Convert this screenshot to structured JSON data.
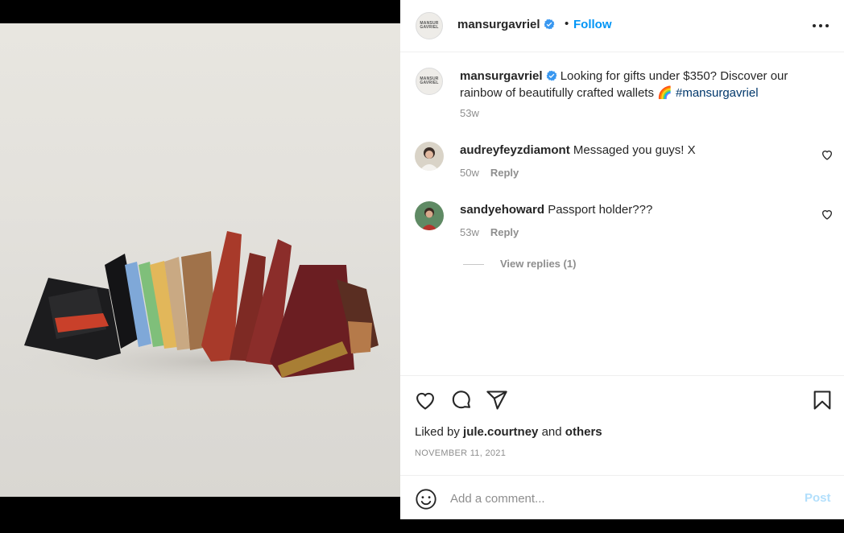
{
  "post": {
    "author": "mansurgavriel",
    "avatar_text": "MANSUR GAVRIEL",
    "follow_label": "Follow",
    "separator": "•",
    "more_icon": "more-horizontal-icon"
  },
  "caption": {
    "username": "mansurgavriel",
    "text": "Looking for gifts under $350? Discover our rainbow of beautifully crafted wallets 🌈",
    "hashtag": "#mansurgavriel",
    "time": "53w"
  },
  "comments": [
    {
      "username": "audreyfeyzdiamont",
      "text": "Messaged you guys! X",
      "time": "50w",
      "reply_label": "Reply"
    },
    {
      "username": "sandyehoward",
      "text": "Passport holder???",
      "time": "53w",
      "reply_label": "Reply"
    }
  ],
  "view_replies_label": "View replies (1)",
  "likes": {
    "prefix": "Liked by",
    "user": "jule.courtney",
    "and": "and",
    "others": "others"
  },
  "date": "NOVEMBER 11, 2021",
  "add_comment": {
    "placeholder": "Add a comment...",
    "post_label": "Post"
  },
  "colors": {
    "accent": "#0095f6",
    "verified": "#3897f0",
    "post_disabled": "#b2dffc",
    "hashtag": "#00376b"
  }
}
